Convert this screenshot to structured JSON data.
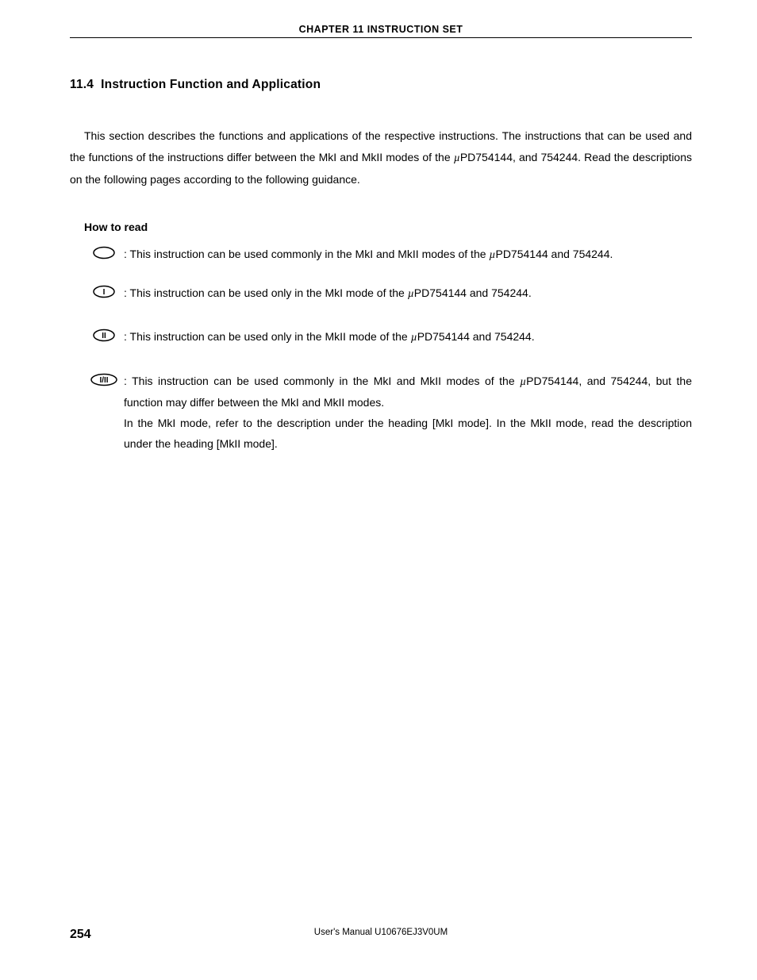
{
  "header": {
    "chapter": "CHAPTER 11   INSTRUCTION SET"
  },
  "section": {
    "number": "11.4",
    "title": "Instruction Function and Application"
  },
  "intro": {
    "text_1": "This section describes the functions and applications of the respective instructions.  The instructions that can be used and the functions of the instructions differ between the MkI and MkII modes of the ",
    "mu": "µ",
    "text_2": "PD754144, and 754244.  Read the descriptions on the following pages according to the following guidance."
  },
  "howto": {
    "title": "How to read",
    "items": [
      {
        "badge": "",
        "desc_pre": ": This instruction can be used commonly in the MkI and MkII modes of the ",
        "mu": "µ",
        "desc_post": "PD754144 and 754244."
      },
      {
        "badge": "I",
        "desc_pre": ": This instruction can be used only in the MkI mode of the ",
        "mu": "µ",
        "desc_post": "PD754144 and 754244."
      },
      {
        "badge": "II",
        "desc_pre": ": This instruction can be used only in the MkII mode of the ",
        "mu": "µ",
        "desc_post": "PD754144 and 754244."
      },
      {
        "badge": "I/II",
        "desc_pre": ": This instruction can be used commonly in the MkI and MkII modes of the ",
        "mu": "µ",
        "desc_post": "PD754144, and 754244, but the function may differ between the MkI and MkII modes.",
        "extra": "In the MkI mode, refer to the description under the heading [MkI mode].  In the MkII mode, read the description under the heading [MkII mode]."
      }
    ]
  },
  "footer": {
    "page": "254",
    "doc": "User's Manual   U10676EJ3V0UM"
  }
}
